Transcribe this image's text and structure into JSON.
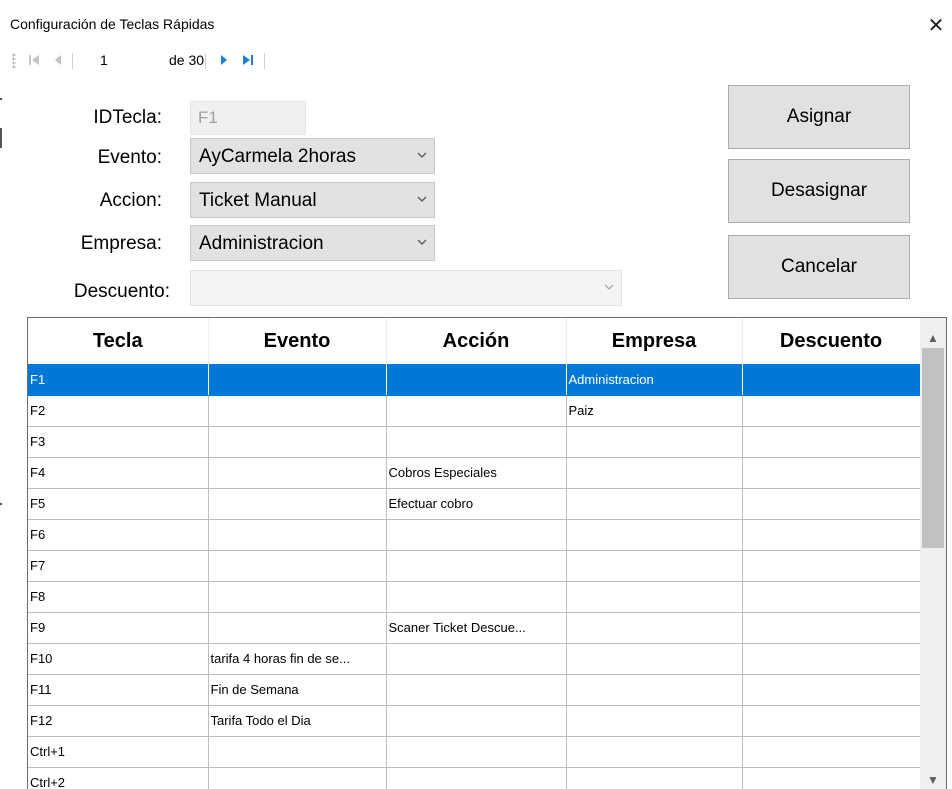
{
  "window": {
    "title": "Configuración de Teclas Rápidas",
    "close_icon": "close-icon"
  },
  "navigator": {
    "position": "1",
    "count": "de 30",
    "buttons": [
      "first-record-icon",
      "previous-record-icon",
      "next-record-icon",
      "last-record-icon"
    ]
  },
  "form": {
    "idtecla_label": "IDTecla:",
    "idtecla_value": "F1",
    "evento_label": "Evento:",
    "evento_value": "AyCarmela 2horas",
    "accion_label": "Accion:",
    "accion_value": "Ticket Manual",
    "empresa_label": "Empresa:",
    "empresa_value": "Administracion",
    "descuento_label": "Descuento:",
    "descuento_value": ""
  },
  "buttons": {
    "asignar": "Asignar",
    "desasignar": "Desasignar",
    "cancelar": "Cancelar"
  },
  "grid": {
    "columns": [
      "Tecla",
      "Evento",
      "Acción",
      "Empresa",
      "Descuento"
    ],
    "rows": [
      [
        "F1",
        "",
        "",
        "Administracion",
        ""
      ],
      [
        "F2",
        "",
        "",
        "Paiz",
        ""
      ],
      [
        "F3",
        "",
        "",
        "",
        ""
      ],
      [
        "F4",
        "",
        "Cobros Especiales",
        "",
        ""
      ],
      [
        "F5",
        "",
        "Efectuar cobro",
        "",
        ""
      ],
      [
        "F6",
        "",
        "",
        "",
        ""
      ],
      [
        "F7",
        "",
        "",
        "",
        ""
      ],
      [
        "F8",
        "",
        "",
        "",
        ""
      ],
      [
        "F9",
        "",
        "Scaner Ticket Descue...",
        "",
        ""
      ],
      [
        "F10",
        "tarifa 4 horas fin de se...",
        "",
        "",
        ""
      ],
      [
        "F11",
        "Fin de Semana",
        "",
        "",
        ""
      ],
      [
        "F12",
        "Tarifa Todo el Dia",
        "",
        "",
        ""
      ],
      [
        "Ctrl+1",
        "",
        "",
        "",
        ""
      ],
      [
        "Ctrl+2",
        "",
        "",
        "",
        ""
      ]
    ],
    "selected_row": 0
  },
  "colors": {
    "selection": "#0078d7",
    "button_face": "#e1e1e1",
    "combo_face": "#e2e2e2",
    "nav_arrow": "#1e7fd6"
  }
}
